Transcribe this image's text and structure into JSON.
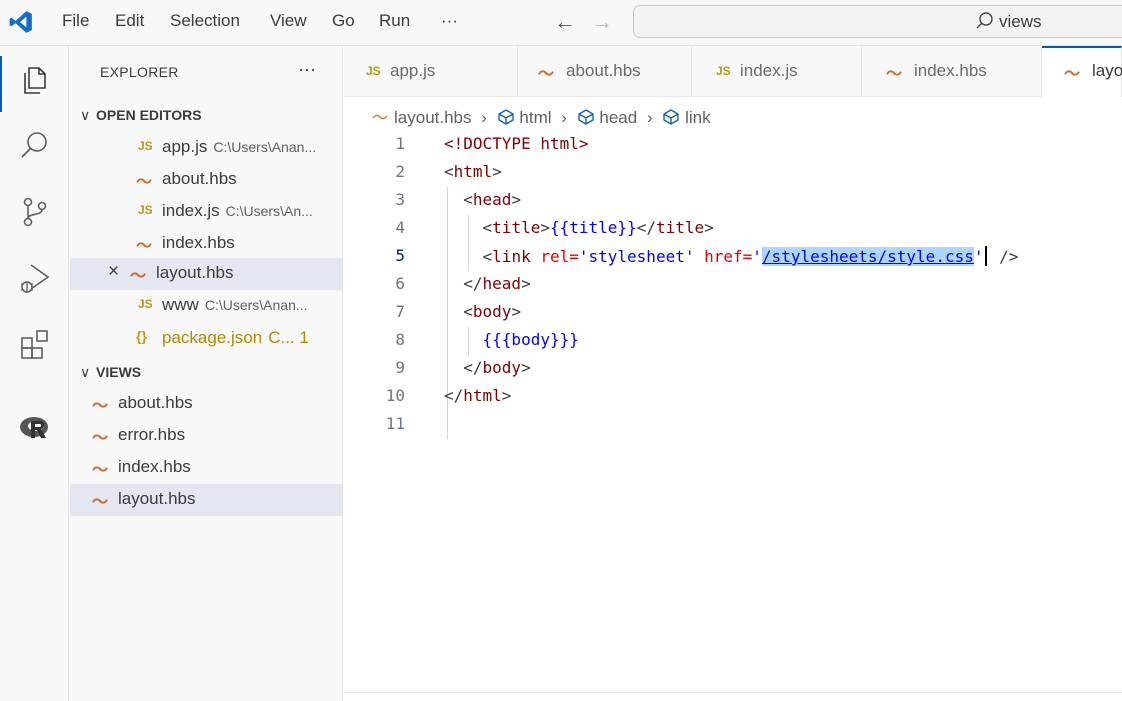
{
  "menu": [
    "File",
    "Edit",
    "Selection",
    "View",
    "Go",
    "Run",
    "···"
  ],
  "search": {
    "text": "views"
  },
  "explorer": {
    "title": "EXPLORER",
    "more": "···",
    "open_editors_label": "OPEN EDITORS",
    "open_editors": [
      {
        "icon": "JS",
        "name": "app.js",
        "path": "C:\\Users\\Anan..."
      },
      {
        "icon": "hbs",
        "name": "about.hbs",
        "path": ""
      },
      {
        "icon": "JS",
        "name": "index.js",
        "path": "C:\\Users\\An..."
      },
      {
        "icon": "hbs",
        "name": "index.hbs",
        "path": ""
      },
      {
        "icon": "hbs",
        "name": "layout.hbs",
        "path": ""
      },
      {
        "icon": "JS",
        "name": "www",
        "path": "C:\\Users\\Anan..."
      },
      {
        "icon": "{}",
        "name": "package.json",
        "path": "C... 1"
      }
    ],
    "views_label": "VIEWS",
    "views": [
      {
        "icon": "hbs",
        "name": "about.hbs"
      },
      {
        "icon": "hbs",
        "name": "error.hbs"
      },
      {
        "icon": "hbs",
        "name": "index.hbs"
      },
      {
        "icon": "hbs",
        "name": "layout.hbs"
      }
    ]
  },
  "tabs": [
    {
      "icon": "JS",
      "label": "app.js"
    },
    {
      "icon": "hbs",
      "label": "about.hbs"
    },
    {
      "icon": "JS",
      "label": "index.js"
    },
    {
      "icon": "hbs",
      "label": "index.hbs"
    },
    {
      "icon": "hbs",
      "label": "layo"
    }
  ],
  "breadcrumb": [
    "layout.hbs",
    "html",
    "head",
    "link"
  ],
  "code": {
    "line_numbers": [
      "1",
      "2",
      "3",
      "4",
      "5",
      "6",
      "7",
      "8",
      "9",
      "10",
      "11"
    ],
    "l1": "<!DOCTYPE html>",
    "l2_tag": "html",
    "l3_tag": "head",
    "l4_tag": "title",
    "l4_mus": "{{title}}",
    "l5_tag": "link",
    "l5_attr1": "rel=",
    "l5_val1": "'stylesheet'",
    "l5_attr2": "href=",
    "l5_q1": "'",
    "l5_sel": "/stylesheets/style.css",
    "l5_q2": "'",
    "l5_end": " />",
    "l6_tag": "head",
    "l7_tag": "body",
    "l8_mus": "{{{body}}}",
    "l9_tag": "body",
    "l10_tag": "html"
  },
  "colors": {
    "accent": "#005fb8",
    "selection": "#add6ff",
    "tag": "#800000",
    "attr": "#e50000",
    "string": "#0000ff"
  }
}
